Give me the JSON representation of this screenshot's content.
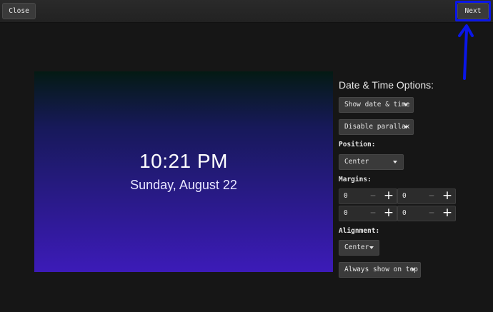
{
  "toolbar": {
    "close_label": "Close",
    "next_label": "Next"
  },
  "preview": {
    "time": "10:21 PM",
    "date": "Sunday, August 22"
  },
  "options": {
    "title": "Date & Time Options:",
    "show_mode": "Show date & time",
    "parallax": "Disable parallax",
    "position_label": "Position:",
    "position_value": "Center",
    "margins_label": "Margins:",
    "margins": [
      "0",
      "0",
      "0",
      "0"
    ],
    "alignment_label": "Alignment:",
    "alignment_value": "Center",
    "visibility": "Always show on top"
  },
  "colors": {
    "highlight": "#0a16e8",
    "gradient_top": "#041a13",
    "gradient_bottom": "#3c1bb8"
  }
}
